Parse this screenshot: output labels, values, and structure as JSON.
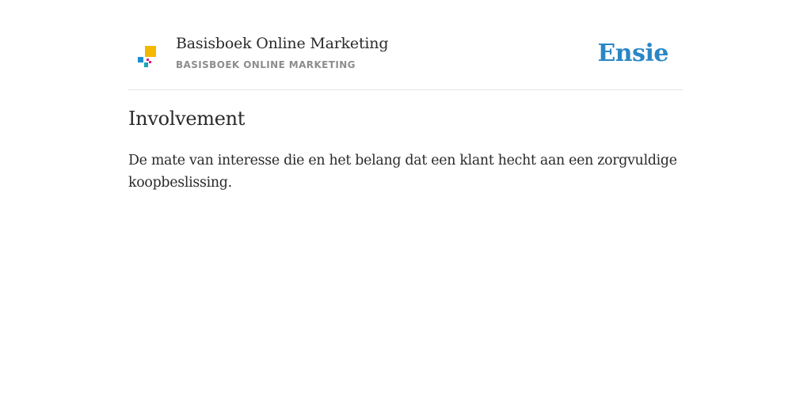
{
  "header": {
    "book_title": "Basisboek Online Marketing",
    "book_subtitle": "BASISBOEK ONLINE MARKETING",
    "brand": "Ensie",
    "logo_icon": "book-logo-icon",
    "colors": {
      "logo_yellow": "#f5b800",
      "logo_blue": "#1c8fd0",
      "logo_pink": "#e2197c",
      "logo_teal": "#1aa5b8",
      "brand": "#2a86c6"
    }
  },
  "entry": {
    "title": "Involvement",
    "definition": "De mate van interesse die en het belang dat een klant hecht aan een zorgvuldige koopbeslissing."
  }
}
